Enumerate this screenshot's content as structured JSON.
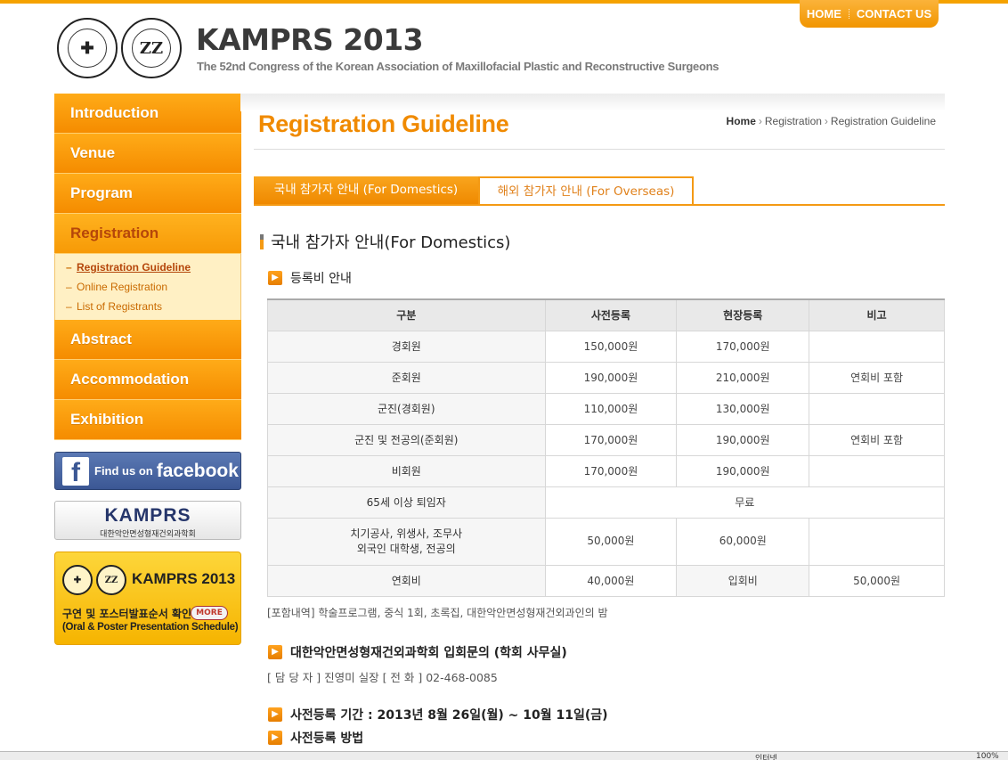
{
  "top_links": {
    "home": "HOME",
    "contact": "CONTACT US"
  },
  "header": {
    "title": "KAMPRS 2013",
    "subtitle": "The 52nd Congress of the Korean Association of Maxillofacial Plastic and Reconstructive Surgeons"
  },
  "nav": {
    "items": [
      "Introduction",
      "Venue",
      "Program",
      "Registration",
      "Abstract",
      "Accommodation",
      "Exhibition"
    ],
    "sub_items": [
      "Registration Guideline",
      "Online Registration",
      "List of Registrants"
    ],
    "sub_dash": "–"
  },
  "banners": {
    "facebook_find": "Find us on",
    "facebook_name": "facebook",
    "kamprs_big": "KAMPRS",
    "kamprs_small": "대한악안면성형재건외과학회",
    "oral_title": "KAMPRS 2013",
    "oral_kr": "구연 및 포스터발표순서 확인",
    "oral_more": "MORE",
    "oral_en": "(Oral & Poster Presentation Schedule)"
  },
  "page": {
    "title": "Registration Guideline",
    "breadcrumb": [
      "Home",
      "Registration",
      "Registration Guideline"
    ],
    "tabs": [
      "국내 참가자 안내 (For Domestics)",
      "해외 참가자 안내 (For Overseas)"
    ],
    "section_title": "국내 참가자 안내(For Domestics)",
    "fee_heading": "등록비 안내",
    "table": {
      "headers": [
        "구분",
        "사전등록",
        "현장등록",
        "비고"
      ],
      "rows": [
        {
          "category": "경회원",
          "pre": "150,000원",
          "onsite": "170,000원",
          "note": ""
        },
        {
          "category": "준회원",
          "pre": "190,000원",
          "onsite": "210,000원",
          "note": "연회비 포함"
        },
        {
          "category": "군진(경회원)",
          "pre": "110,000원",
          "onsite": "130,000원",
          "note": ""
        },
        {
          "category": "군진 및 전공의(준회원)",
          "pre": "170,000원",
          "onsite": "190,000원",
          "note": "연회비 포함"
        },
        {
          "category": "비회원",
          "pre": "170,000원",
          "onsite": "190,000원",
          "note": ""
        }
      ],
      "retired_category": "65세 이상 퇴임자",
      "retired_value": "무료",
      "staff_category_line1": "치기공사, 위생사, 조무사",
      "staff_category_line2": "외국인 대학생, 전공의",
      "staff_pre": "50,000원",
      "staff_onsite": "60,000원",
      "fee_category": "연회비",
      "fee_value": "40,000원",
      "entry_category": "입회비",
      "entry_value": "50,000원"
    },
    "included_note": "[포함내역] 학술프로그램, 중식 1회, 초록집, 대한악안면성형재건외과인의 밤",
    "membership_heading": "대한악안면성형재건외과학회 입회문의 (학회 사무실)",
    "contact_line": "[ 담 당 자 ] 진영미 실장 [ 전 화 ] 02-468-0085",
    "pre_period_heading": "사전등록 기간 : 2013년 8월 26일(월) ~ 10월 11일(금)",
    "pre_method_heading": "사전등록 방법"
  },
  "statusbar": {
    "zone": "인터넷",
    "zoom": "100%"
  },
  "colors": {
    "accent": "#f08a00",
    "nav": "#f79a06",
    "facebook": "#3b5794"
  }
}
